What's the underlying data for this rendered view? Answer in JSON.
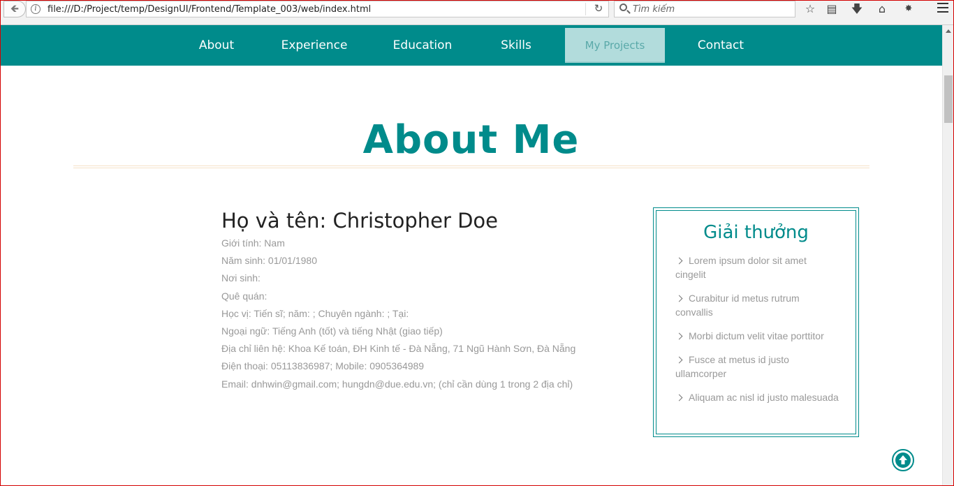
{
  "browser": {
    "url": "file:///D:/Project/temp/DesignUI/Frontend/Template_003/web/index.html",
    "search_placeholder": "Tìm kiếm"
  },
  "nav": {
    "items": [
      {
        "label": "About"
      },
      {
        "label": "Experience"
      },
      {
        "label": "Education"
      },
      {
        "label": "Skills"
      },
      {
        "label": "My Projects",
        "active": true
      },
      {
        "label": "Contact"
      }
    ]
  },
  "page": {
    "heading": "About Me"
  },
  "profile": {
    "name": "Họ và tên: Christopher Doe",
    "lines": [
      "Giới tính: Nam",
      "Năm sinh: 01/01/1980",
      "Nơi sinh:",
      "Quê quán:",
      "Học vị: Tiến sĩ; năm: ; Chuyên ngành: ; Tại:",
      "Ngoại ngữ: Tiếng Anh (tốt) và tiếng Nhật (giao tiếp)",
      "Địa chỉ liên hệ: Khoa Kế toán, ĐH Kinh tế - Đà Nẵng, 71 Ngũ Hành Sơn, Đà Nẵng",
      "Điện thoại: 05113836987; Mobile: 0905364989",
      "Email: dnhwin@gmail.com; hungdn@due.edu.vn; (chỉ cần dùng 1 trong 2 địa chỉ)"
    ]
  },
  "awards": {
    "title": "Giải thưởng",
    "items": [
      "Lorem ipsum dolor sit amet cingelit",
      "Curabitur id metus rutrum convallis",
      "Morbi dictum velit vitae porttitor",
      "Fusce at metus id justo ullamcorper",
      "Aliquam ac nisl id justo malesuada"
    ]
  },
  "colors": {
    "accent": "#008b8b",
    "active_tab_bg": "#b2dcdc",
    "body_text": "#999999"
  }
}
